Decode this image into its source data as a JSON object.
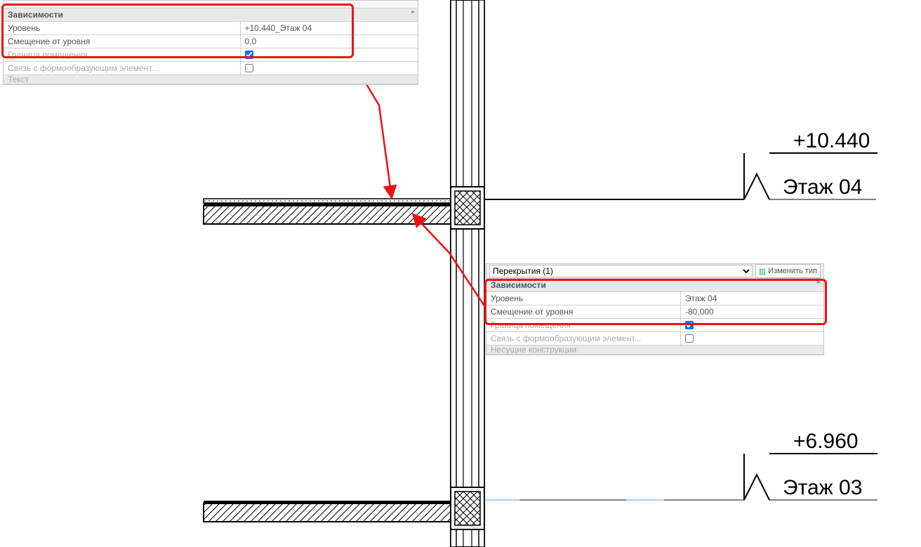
{
  "panel_top": {
    "section": "Зависимости",
    "rows": [
      {
        "label": "Уровень",
        "value": "+10.440_Этаж 04"
      },
      {
        "label": "Смещение от уровня",
        "value": "0.0"
      }
    ],
    "extras": [
      {
        "label": "Граница помещения",
        "checked": true
      },
      {
        "label": "Связь с формообразующим элемент...",
        "checked": false
      }
    ],
    "footer_partial": "Текст"
  },
  "panel_bottom": {
    "selector": "Перекрытия (1)",
    "edit_type_btn": "Изменить тип",
    "section": "Зависимости",
    "rows": [
      {
        "label": "Уровень",
        "value": "Этаж 04"
      },
      {
        "label": "Смещение от уровня",
        "value": "-80,000"
      }
    ],
    "extras": [
      {
        "label": "Граница помещения",
        "checked": true
      },
      {
        "label": "Связь с формообразующим элемент...",
        "checked": false
      }
    ],
    "footer_partial": "Несущие конструкции"
  },
  "levels": {
    "l04": {
      "elev": "+10.440",
      "name": "Этаж 04"
    },
    "l03": {
      "elev": "+6.960",
      "name": "Этаж 03"
    }
  }
}
